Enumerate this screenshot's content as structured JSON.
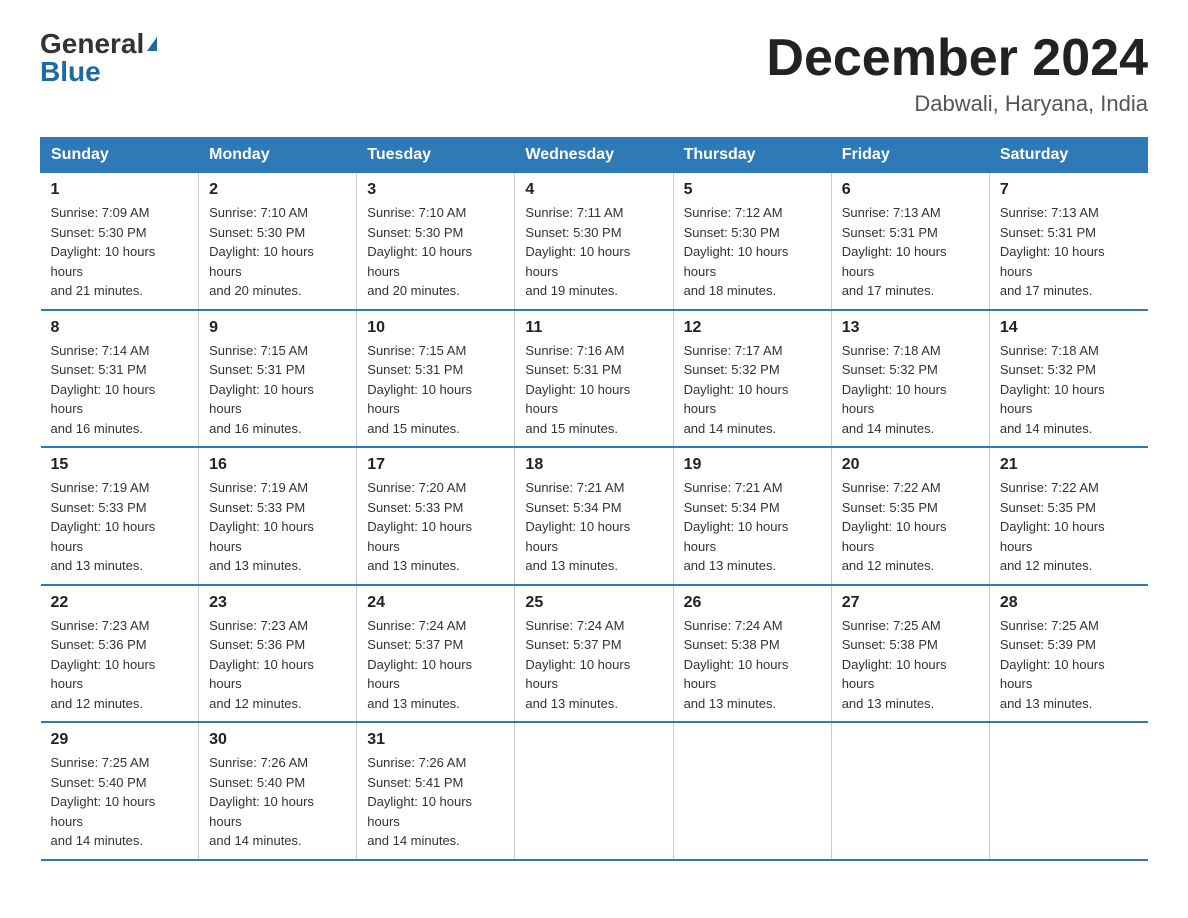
{
  "logo": {
    "general": "General",
    "blue": "Blue"
  },
  "title": "December 2024",
  "location": "Dabwali, Haryana, India",
  "days_of_week": [
    "Sunday",
    "Monday",
    "Tuesday",
    "Wednesday",
    "Thursday",
    "Friday",
    "Saturday"
  ],
  "weeks": [
    [
      {
        "day": "1",
        "sunrise": "7:09 AM",
        "sunset": "5:30 PM",
        "daylight": "10 hours and 21 minutes."
      },
      {
        "day": "2",
        "sunrise": "7:10 AM",
        "sunset": "5:30 PM",
        "daylight": "10 hours and 20 minutes."
      },
      {
        "day": "3",
        "sunrise": "7:10 AM",
        "sunset": "5:30 PM",
        "daylight": "10 hours and 20 minutes."
      },
      {
        "day": "4",
        "sunrise": "7:11 AM",
        "sunset": "5:30 PM",
        "daylight": "10 hours and 19 minutes."
      },
      {
        "day": "5",
        "sunrise": "7:12 AM",
        "sunset": "5:30 PM",
        "daylight": "10 hours and 18 minutes."
      },
      {
        "day": "6",
        "sunrise": "7:13 AM",
        "sunset": "5:31 PM",
        "daylight": "10 hours and 17 minutes."
      },
      {
        "day": "7",
        "sunrise": "7:13 AM",
        "sunset": "5:31 PM",
        "daylight": "10 hours and 17 minutes."
      }
    ],
    [
      {
        "day": "8",
        "sunrise": "7:14 AM",
        "sunset": "5:31 PM",
        "daylight": "10 hours and 16 minutes."
      },
      {
        "day": "9",
        "sunrise": "7:15 AM",
        "sunset": "5:31 PM",
        "daylight": "10 hours and 16 minutes."
      },
      {
        "day": "10",
        "sunrise": "7:15 AM",
        "sunset": "5:31 PM",
        "daylight": "10 hours and 15 minutes."
      },
      {
        "day": "11",
        "sunrise": "7:16 AM",
        "sunset": "5:31 PM",
        "daylight": "10 hours and 15 minutes."
      },
      {
        "day": "12",
        "sunrise": "7:17 AM",
        "sunset": "5:32 PM",
        "daylight": "10 hours and 14 minutes."
      },
      {
        "day": "13",
        "sunrise": "7:18 AM",
        "sunset": "5:32 PM",
        "daylight": "10 hours and 14 minutes."
      },
      {
        "day": "14",
        "sunrise": "7:18 AM",
        "sunset": "5:32 PM",
        "daylight": "10 hours and 14 minutes."
      }
    ],
    [
      {
        "day": "15",
        "sunrise": "7:19 AM",
        "sunset": "5:33 PM",
        "daylight": "10 hours and 13 minutes."
      },
      {
        "day": "16",
        "sunrise": "7:19 AM",
        "sunset": "5:33 PM",
        "daylight": "10 hours and 13 minutes."
      },
      {
        "day": "17",
        "sunrise": "7:20 AM",
        "sunset": "5:33 PM",
        "daylight": "10 hours and 13 minutes."
      },
      {
        "day": "18",
        "sunrise": "7:21 AM",
        "sunset": "5:34 PM",
        "daylight": "10 hours and 13 minutes."
      },
      {
        "day": "19",
        "sunrise": "7:21 AM",
        "sunset": "5:34 PM",
        "daylight": "10 hours and 13 minutes."
      },
      {
        "day": "20",
        "sunrise": "7:22 AM",
        "sunset": "5:35 PM",
        "daylight": "10 hours and 12 minutes."
      },
      {
        "day": "21",
        "sunrise": "7:22 AM",
        "sunset": "5:35 PM",
        "daylight": "10 hours and 12 minutes."
      }
    ],
    [
      {
        "day": "22",
        "sunrise": "7:23 AM",
        "sunset": "5:36 PM",
        "daylight": "10 hours and 12 minutes."
      },
      {
        "day": "23",
        "sunrise": "7:23 AM",
        "sunset": "5:36 PM",
        "daylight": "10 hours and 12 minutes."
      },
      {
        "day": "24",
        "sunrise": "7:24 AM",
        "sunset": "5:37 PM",
        "daylight": "10 hours and 13 minutes."
      },
      {
        "day": "25",
        "sunrise": "7:24 AM",
        "sunset": "5:37 PM",
        "daylight": "10 hours and 13 minutes."
      },
      {
        "day": "26",
        "sunrise": "7:24 AM",
        "sunset": "5:38 PM",
        "daylight": "10 hours and 13 minutes."
      },
      {
        "day": "27",
        "sunrise": "7:25 AM",
        "sunset": "5:38 PM",
        "daylight": "10 hours and 13 minutes."
      },
      {
        "day": "28",
        "sunrise": "7:25 AM",
        "sunset": "5:39 PM",
        "daylight": "10 hours and 13 minutes."
      }
    ],
    [
      {
        "day": "29",
        "sunrise": "7:25 AM",
        "sunset": "5:40 PM",
        "daylight": "10 hours and 14 minutes."
      },
      {
        "day": "30",
        "sunrise": "7:26 AM",
        "sunset": "5:40 PM",
        "daylight": "10 hours and 14 minutes."
      },
      {
        "day": "31",
        "sunrise": "7:26 AM",
        "sunset": "5:41 PM",
        "daylight": "10 hours and 14 minutes."
      },
      null,
      null,
      null,
      null
    ]
  ],
  "labels": {
    "sunrise": "Sunrise:",
    "sunset": "Sunset:",
    "daylight": "Daylight:"
  }
}
